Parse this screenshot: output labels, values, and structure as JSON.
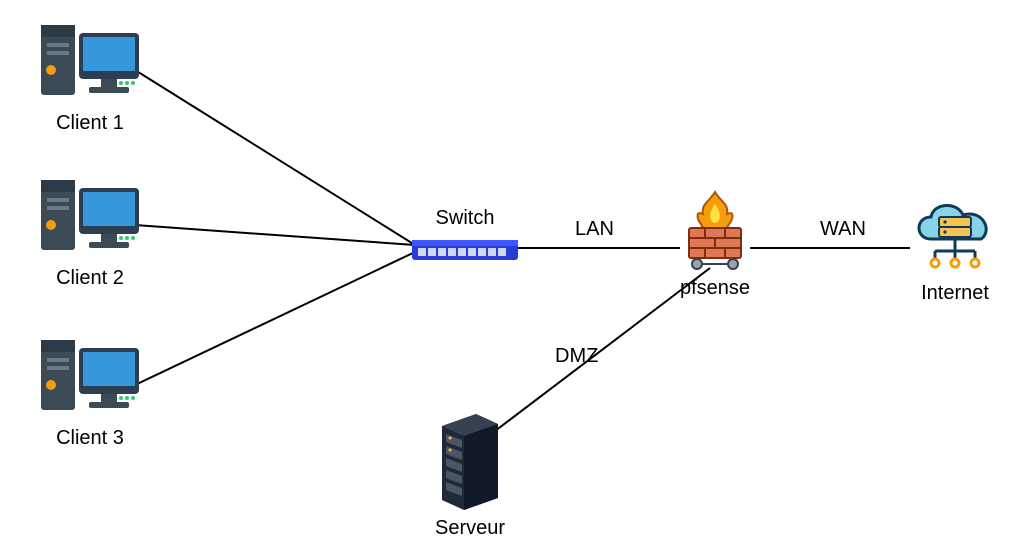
{
  "nodes": {
    "client1": {
      "label": "Client 1"
    },
    "client2": {
      "label": "Client 2"
    },
    "client3": {
      "label": "Client 3"
    },
    "switch": {
      "label": "Switch"
    },
    "pfsense": {
      "label": "pfsense"
    },
    "internet": {
      "label": "Internet"
    },
    "serveur": {
      "label": "Serveur"
    }
  },
  "links": {
    "lan": {
      "label": "LAN"
    },
    "wan": {
      "label": "WAN"
    },
    "dmz": {
      "label": "DMZ"
    }
  },
  "topology": {
    "description": "Three clients connect to a Switch. Switch LAN side goes to pfsense firewall. pfsense WAN side goes to Internet. pfsense DMZ side goes to Serveur.",
    "edges": [
      {
        "from": "client1",
        "to": "switch"
      },
      {
        "from": "client2",
        "to": "switch"
      },
      {
        "from": "client3",
        "to": "switch"
      },
      {
        "from": "switch",
        "to": "pfsense",
        "label": "LAN"
      },
      {
        "from": "pfsense",
        "to": "internet",
        "label": "WAN"
      },
      {
        "from": "pfsense",
        "to": "serveur",
        "label": "DMZ"
      }
    ]
  }
}
